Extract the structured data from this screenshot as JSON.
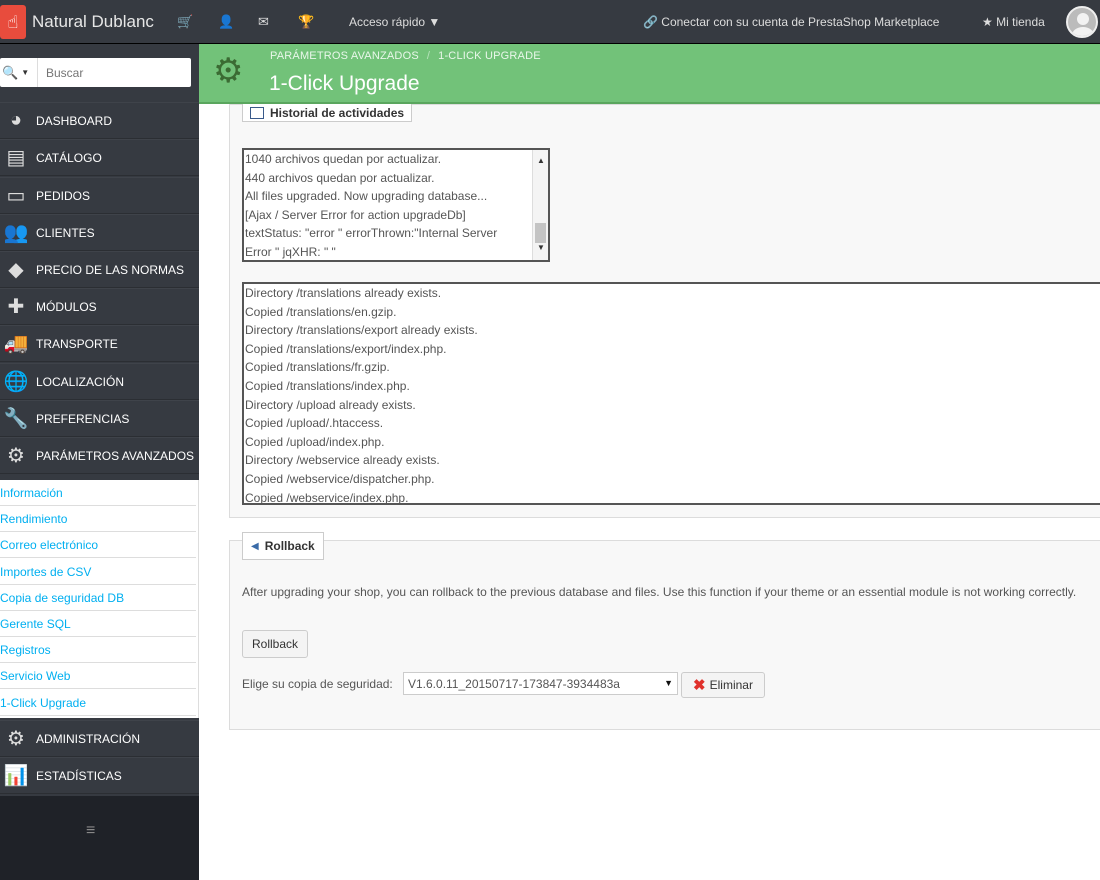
{
  "topbar": {
    "shop_name": "Natural Dublanc",
    "quick_access": "Acceso rápido",
    "marketplace": "Conectar con su cuenta de PrestaShop Marketplace",
    "my_shop": "Mi tienda"
  },
  "search": {
    "placeholder": "Buscar"
  },
  "nav": [
    {
      "label": "DASHBOARD",
      "icon": "dashboard-icon"
    },
    {
      "label": "CATÁLOGO",
      "icon": "book-icon"
    },
    {
      "label": "PEDIDOS",
      "icon": "credit-card-icon"
    },
    {
      "label": "CLIENTES",
      "icon": "users-icon"
    },
    {
      "label": "PRECIO DE LAS NORMAS",
      "icon": "tag-icon"
    },
    {
      "label": "MÓDULOS",
      "icon": "puzzle-icon"
    },
    {
      "label": "TRANSPORTE",
      "icon": "truck-icon"
    },
    {
      "label": "LOCALIZACIÓN",
      "icon": "globe-icon"
    },
    {
      "label": "PREFERENCIAS",
      "icon": "wrench-icon"
    },
    {
      "label": "PARÁMETROS AVANZADOS",
      "icon": "cogs-icon"
    },
    {
      "label": "ADMINISTRACIÓN",
      "icon": "cog-icon"
    },
    {
      "label": "ESTADÍSTICAS",
      "icon": "bar-chart-icon"
    }
  ],
  "submenu": [
    "Información",
    "Rendimiento",
    "Correo electrónico",
    "Importes de CSV",
    "Copia de seguridad DB",
    "Gerente SQL",
    "Registros",
    "Servicio Web",
    "1-Click Upgrade"
  ],
  "header": {
    "breadcrumb_parent": "PARÁMETROS AVANZADOS",
    "breadcrumb_current": "1-CLICK UPGRADE",
    "title": "1-Click Upgrade"
  },
  "history": {
    "legend": "Historial de actividades",
    "short_log": [
      "1040 archivos quedan por actualizar.",
      "440 archivos quedan por actualizar.",
      "All files upgraded. Now upgrading database...",
      "[Ajax / Server Error for action upgradeDb]",
      "textStatus: \"error \" errorThrown:\"Internal Server",
      "Error \" jqXHR: \" \""
    ],
    "long_log": [
      "Directory /translations already exists.",
      "Copied /translations/en.gzip.",
      "Directory /translations/export already exists.",
      "Copied /translations/export/index.php.",
      "Copied /translations/fr.gzip.",
      "Copied /translations/index.php.",
      "Directory /upload already exists.",
      "Copied /upload/.htaccess.",
      "Copied /upload/index.php.",
      "Directory /webservice already exists.",
      "Copied /webservice/dispatcher.php.",
      "Copied /webservice/index.php."
    ]
  },
  "rollback": {
    "legend": "Rollback",
    "description": "After upgrading your shop, you can rollback to the previous database and files. Use this function if your theme or an essential module is not working correctly.",
    "button": "Rollback",
    "backup_label": "Elige su copia de seguridad:",
    "backup_value": "V1.6.0.11_20150717-173847-3934483a",
    "delete_button": "Eliminar"
  },
  "colors": {
    "sidebar": "#363a41",
    "header_green": "#72c279",
    "link_blue": "#00aff0"
  }
}
